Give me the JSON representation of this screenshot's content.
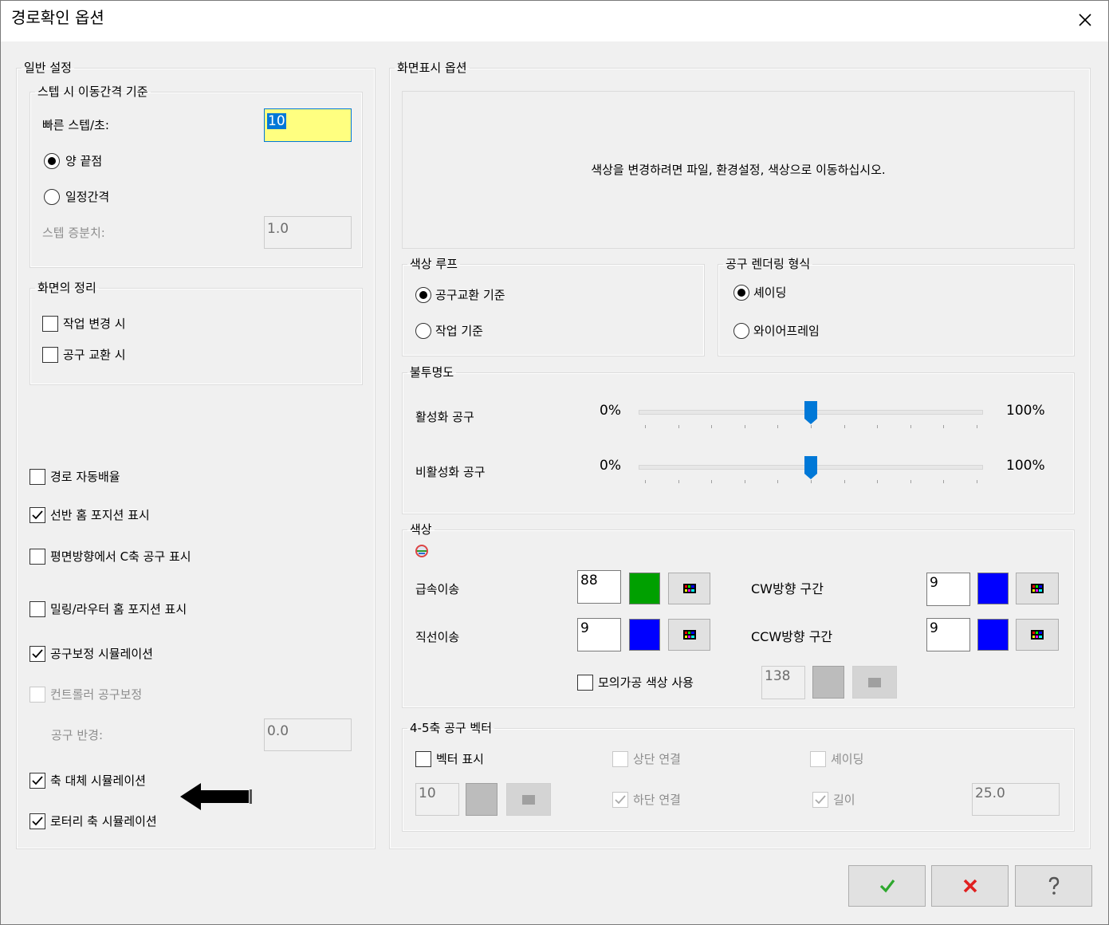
{
  "window": {
    "title": "경로확인 옵션"
  },
  "general": {
    "legend": "일반 설정",
    "step": {
      "legend": "스텝 시 이동간격 기준",
      "fast_label": "빠른 스텝/초:",
      "fast_value": "10",
      "radio_both_ends": "양 끝점",
      "radio_constant": "일정간격",
      "increment_label": "스텝 증분치:",
      "increment_value": "1.0"
    },
    "cleanup": {
      "legend": "화면의 정리",
      "on_job_change": "작업 변경 시",
      "on_tool_change": "공구 교환 시"
    },
    "options": {
      "auto_zoom": "경로 자동배율",
      "lathe_home": "선반 홈 포지션 표시",
      "c_axis_tool": "평면방향에서 C축 공구 표시",
      "mill_home": "밀링/라우터 홈 포지션 표시",
      "comp_sim": "공구보정 시뮬레이션",
      "controller_comp": "컨트롤러 공구보정",
      "tool_radius_label": "공구 반경:",
      "tool_radius_value": "0.0",
      "axis_sub_sim": "축 대체 시뮬레이션",
      "rotary_sim": "로터리 축 시뮬레이션"
    }
  },
  "display": {
    "legend": "화면표시 옵션",
    "hint": "색상을 변경하려면 파일, 환경설정, 색상으로 이동하십시오.",
    "color_loop": {
      "legend": "색상 루프",
      "by_tool_change": "공구교환 기준",
      "by_job": "작업 기준"
    },
    "render": {
      "legend": "공구 렌더링 형식",
      "shading": "셰이딩",
      "wireframe": "와이어프레임"
    },
    "opacity": {
      "legend": "불투명도",
      "active_tool": "활성화 공구",
      "inactive_tool": "비활성화 공구",
      "min": "0%",
      "max": "100%",
      "active_value": 0.5,
      "inactive_value": 0.5
    },
    "colors": {
      "legend": "색상",
      "rapid_label": "급속이송",
      "rapid_value": "88",
      "rapid_color": "#00a000",
      "linear_label": "직선이송",
      "linear_value": "9",
      "linear_color": "#0000ff",
      "cw_label": "CW방향 구간",
      "cw_value": "9",
      "cw_color": "#0000ff",
      "ccw_label": "CCW방향 구간",
      "ccw_value": "9",
      "ccw_color": "#0000ff",
      "use_sim_color": "모의가공 색상 사용",
      "sim_value": "138",
      "sim_color": "#bcbcbc"
    },
    "vector": {
      "legend": "4-5축 공구 벡터",
      "show_vector": "벡터 표시",
      "top_connect": "상단 연결",
      "shading": "셰이딩",
      "bottom_connect": "하단 연결",
      "length": "길이",
      "color_value": "10",
      "length_value": "25.0",
      "swatch_color": "#bcbcbc"
    }
  },
  "buttons": {
    "ok_icon": "check-icon",
    "cancel_icon": "x-icon",
    "help_icon": "question-icon"
  },
  "colors": {
    "accent": "#0078d7",
    "ok": "#2ea82e",
    "cancel": "#e02020"
  }
}
